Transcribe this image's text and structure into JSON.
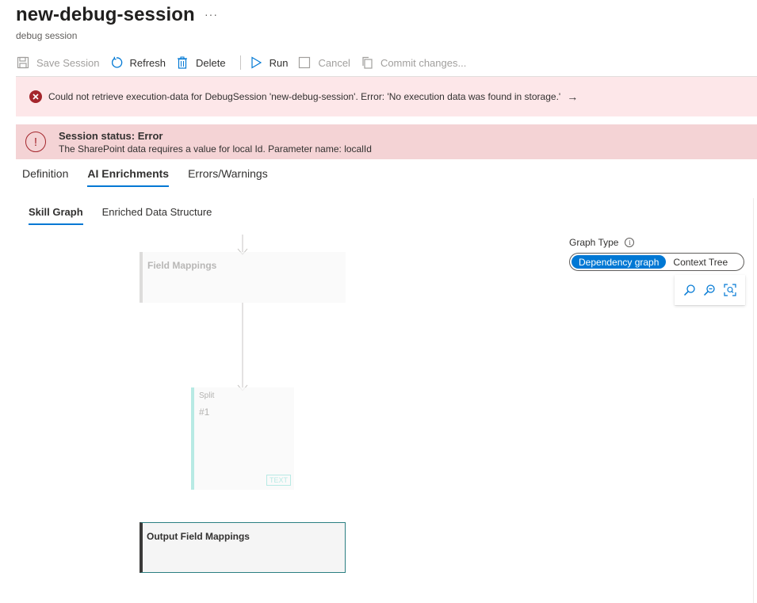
{
  "header": {
    "title": "new-debug-session",
    "more": "···",
    "subtitle": "debug session"
  },
  "toolbar": {
    "save_label": "Save Session",
    "refresh_label": "Refresh",
    "delete_label": "Delete",
    "run_label": "Run",
    "cancel_label": "Cancel",
    "commit_label": "Commit changes..."
  },
  "error_bar": {
    "message": "Could not retrieve execution-data for DebugSession 'new-debug-session'. Error: 'No execution data was found in storage.'",
    "arrow": "→"
  },
  "status": {
    "title": "Session status: Error",
    "detail": "The SharePoint data requires a value for local Id. Parameter name: localId",
    "icon": "!"
  },
  "tabs": [
    "Definition",
    "AI Enrichments",
    "Errors/Warnings"
  ],
  "active_tab": "AI Enrichments",
  "subtabs": [
    "Skill Graph",
    "Enriched Data Structure"
  ],
  "active_subtab": "Skill Graph",
  "graph_type": {
    "label": "Graph Type",
    "info_icon": "i",
    "options": [
      "Dependency graph",
      "Context Tree"
    ],
    "selected": "Dependency graph"
  },
  "zoom_controls": [
    "zoom-in-icon",
    "zoom-out-icon",
    "fit-to-screen-icon"
  ],
  "graph": {
    "field_mappings": "Field Mappings",
    "split_type": "Split",
    "split_id": "#1",
    "split_badge": "TEXT",
    "output_field_mappings": "Output Field Mappings"
  },
  "colors": {
    "accent": "#0078d4",
    "error": "#a4262c",
    "error_bar_bg": "#fde7e9",
    "status_bar_bg": "#f4d3d5",
    "split_accent": "#a6e5de",
    "output_border": "#2b7f82"
  }
}
